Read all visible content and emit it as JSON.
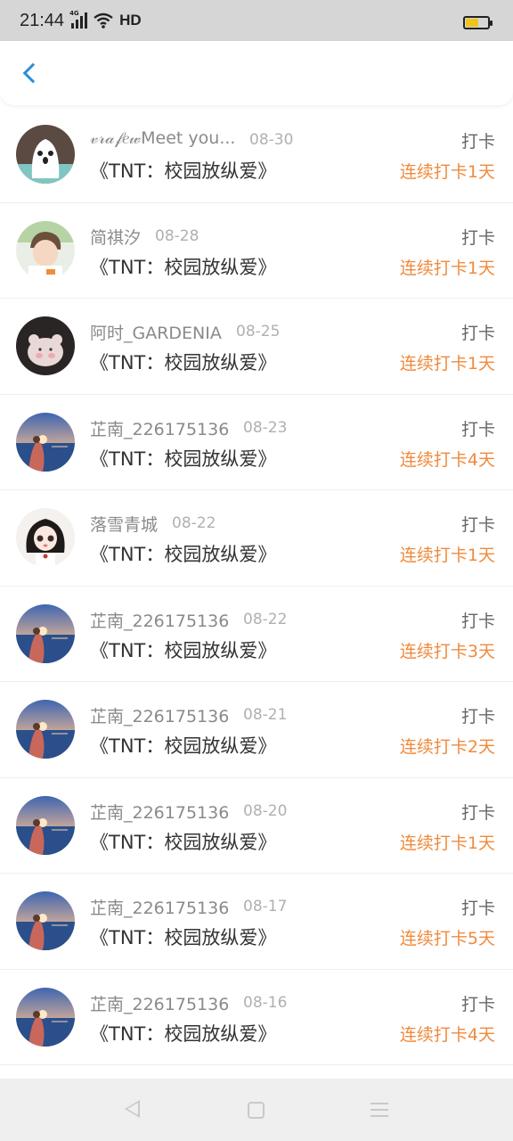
{
  "status_bar": {
    "time": "21:44",
    "network": "4G",
    "hd": "HD",
    "battery_icon": "battery-low-icon"
  },
  "header": {
    "back_icon": "chevron-left-icon",
    "accent_color": "#2b8fd6"
  },
  "colors": {
    "streak": "#f08a3c",
    "username": "#8a8a8a",
    "date": "#b0b0b0"
  },
  "records": [
    {
      "user": "𝓋𝓇𝒶𝒻𝑒𝓌Meet you...",
      "date": "08-30",
      "book": "《TNT：校园放纵爱》",
      "action": "打卡",
      "streak": "连续打卡1天",
      "avatar": "ghost"
    },
    {
      "user": "简祺汐",
      "date": "08-28",
      "book": "《TNT：校园放纵爱》",
      "action": "打卡",
      "streak": "连续打卡1天",
      "avatar": "boy"
    },
    {
      "user": "阿时_GARDENIA",
      "date": "08-25",
      "book": "《TNT：校园放纵爱》",
      "action": "打卡",
      "streak": "连续打卡1天",
      "avatar": "bear"
    },
    {
      "user": "芷南_226175136",
      "date": "08-23",
      "book": "《TNT：校园放纵爱》",
      "action": "打卡",
      "streak": "连续打卡4天",
      "avatar": "sea"
    },
    {
      "user": "落雪青城",
      "date": "08-22",
      "book": "《TNT：校园放纵爱》",
      "action": "打卡",
      "streak": "连续打卡1天",
      "avatar": "doll"
    },
    {
      "user": "芷南_226175136",
      "date": "08-22",
      "book": "《TNT：校园放纵爱》",
      "action": "打卡",
      "streak": "连续打卡3天",
      "avatar": "sea"
    },
    {
      "user": "芷南_226175136",
      "date": "08-21",
      "book": "《TNT：校园放纵爱》",
      "action": "打卡",
      "streak": "连续打卡2天",
      "avatar": "sea"
    },
    {
      "user": "芷南_226175136",
      "date": "08-20",
      "book": "《TNT：校园放纵爱》",
      "action": "打卡",
      "streak": "连续打卡1天",
      "avatar": "sea"
    },
    {
      "user": "芷南_226175136",
      "date": "08-17",
      "book": "《TNT：校园放纵爱》",
      "action": "打卡",
      "streak": "连续打卡5天",
      "avatar": "sea"
    },
    {
      "user": "芷南_226175136",
      "date": "08-16",
      "book": "《TNT：校园放纵爱》",
      "action": "打卡",
      "streak": "连续打卡4天",
      "avatar": "sea"
    }
  ],
  "nav_bar": {
    "back": "nav-back-icon",
    "home": "nav-home-icon",
    "menu": "nav-menu-icon"
  }
}
